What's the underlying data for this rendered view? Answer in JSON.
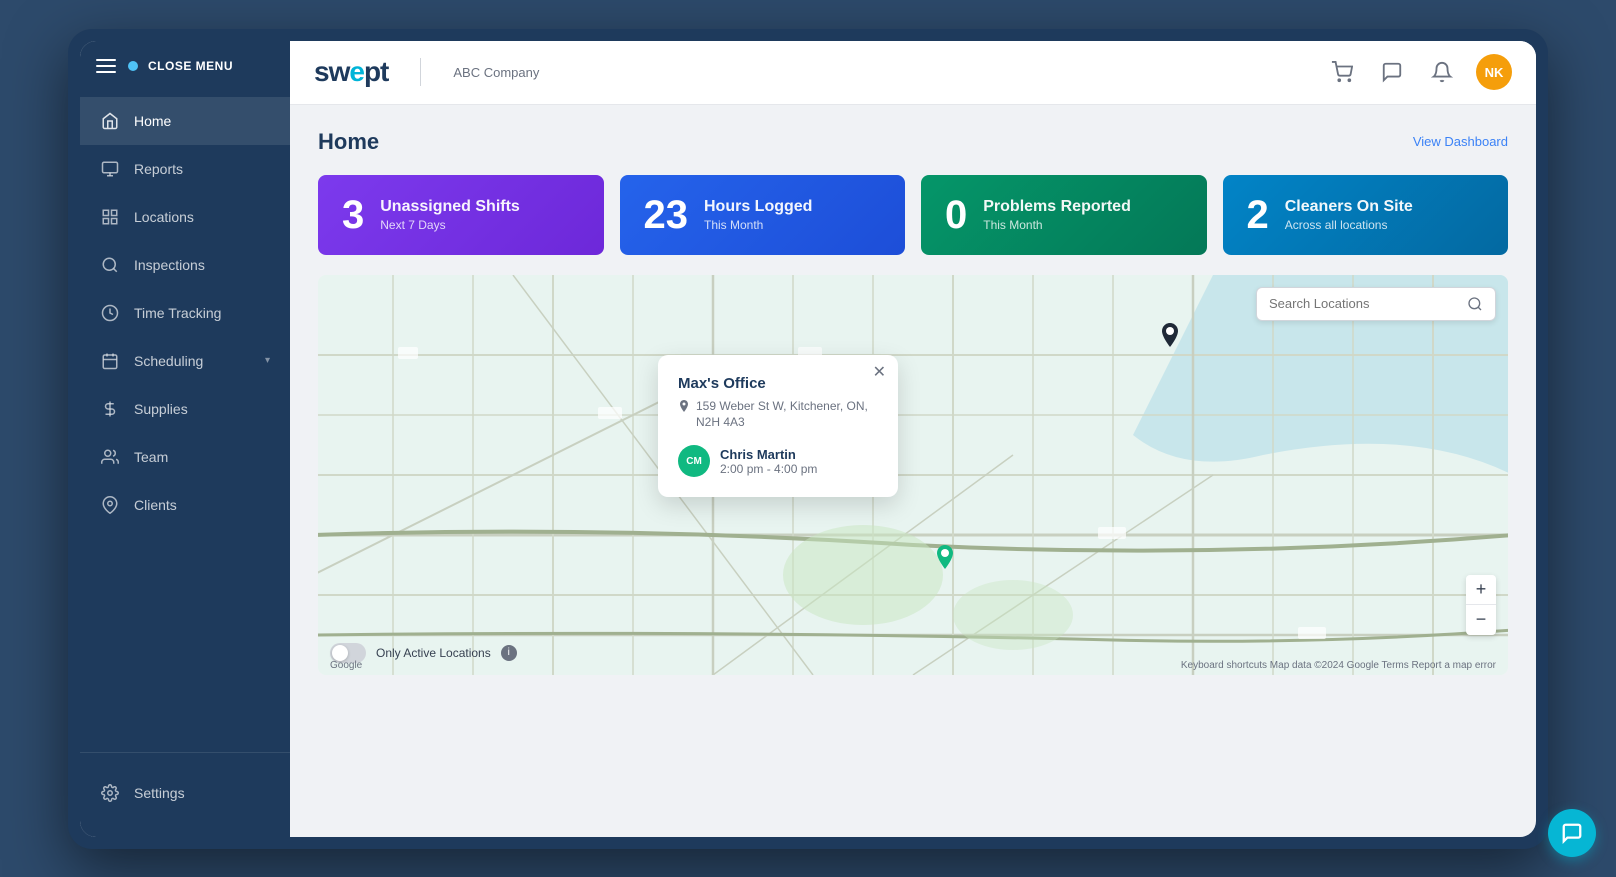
{
  "app": {
    "name": "swept",
    "company": "ABC Company"
  },
  "header": {
    "avatar_initials": "NK",
    "avatar_color": "#f59e0b"
  },
  "sidebar": {
    "close_menu_label": "CLOSE MENU",
    "items": [
      {
        "id": "home",
        "label": "Home",
        "active": true
      },
      {
        "id": "reports",
        "label": "Reports",
        "active": false
      },
      {
        "id": "locations",
        "label": "Locations",
        "active": false
      },
      {
        "id": "inspections",
        "label": "Inspections",
        "active": false
      },
      {
        "id": "time-tracking",
        "label": "Time Tracking",
        "active": false
      },
      {
        "id": "scheduling",
        "label": "Scheduling",
        "active": false,
        "has_chevron": true
      },
      {
        "id": "supplies",
        "label": "Supplies",
        "active": false
      },
      {
        "id": "team",
        "label": "Team",
        "active": false
      },
      {
        "id": "clients",
        "label": "Clients",
        "active": false
      }
    ],
    "bottom_items": [
      {
        "id": "settings",
        "label": "Settings"
      }
    ]
  },
  "page": {
    "title": "Home",
    "view_dashboard_link": "View Dashboard"
  },
  "stats": [
    {
      "id": "unassigned-shifts",
      "number": "3",
      "title": "Unassigned Shifts",
      "subtitle": "Next 7 Days",
      "color": "purple"
    },
    {
      "id": "hours-logged",
      "number": "23",
      "title": "Hours Logged",
      "subtitle": "This Month",
      "color": "blue"
    },
    {
      "id": "problems-reported",
      "number": "0",
      "title": "Problems Reported",
      "subtitle": "This Month",
      "color": "green"
    },
    {
      "id": "cleaners-on-site",
      "number": "2",
      "title": "Cleaners On Site",
      "subtitle": "Across all locations",
      "color": "teal"
    }
  ],
  "map": {
    "search_placeholder": "Search Locations",
    "popup": {
      "location_name": "Max's Office",
      "address": "159 Weber St W, Kitchener, ON, N2H 4A3",
      "cleaner": {
        "name": "Chris Martin",
        "initials": "CM",
        "time": "2:00 pm - 4:00 pm"
      }
    },
    "bottom_label": "Only Active Locations",
    "attribution": "Keyboard shortcuts  Map data ©2024 Google  Terms  Report a map error",
    "google_logo": "Google",
    "zoom_in": "+",
    "zoom_out": "−"
  }
}
